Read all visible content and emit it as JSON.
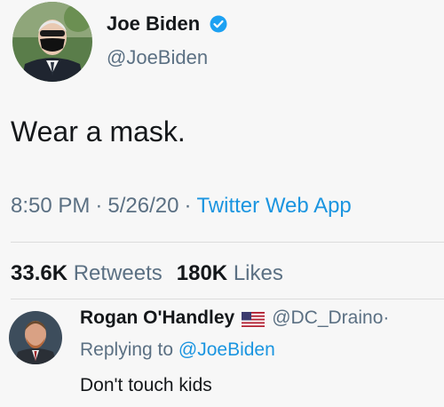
{
  "tweet": {
    "author_name": "Joe Biden",
    "author_handle": "@JoeBiden",
    "verified": true,
    "text": "Wear a mask.",
    "time": "8:50 PM",
    "date": "5/26/20",
    "separator": "·",
    "source": "Twitter Web App",
    "retweets_count": "33.6K",
    "retweets_label": "Retweets",
    "likes_count": "180K",
    "likes_label": "Likes"
  },
  "reply": {
    "author_name": "Rogan O'Handley",
    "flag_icon": "us-flag-icon",
    "author_handle": "@DC_Draino",
    "trailing_separator": "·",
    "replying_to_label": "Replying to",
    "replying_to_handle": "@JoeBiden",
    "text": "Don't touch kids"
  },
  "colors": {
    "handle_gray": "#5b7083",
    "link_blue": "#1b95e0",
    "verified_blue": "#1da1f2",
    "text_dark": "#14171a"
  }
}
